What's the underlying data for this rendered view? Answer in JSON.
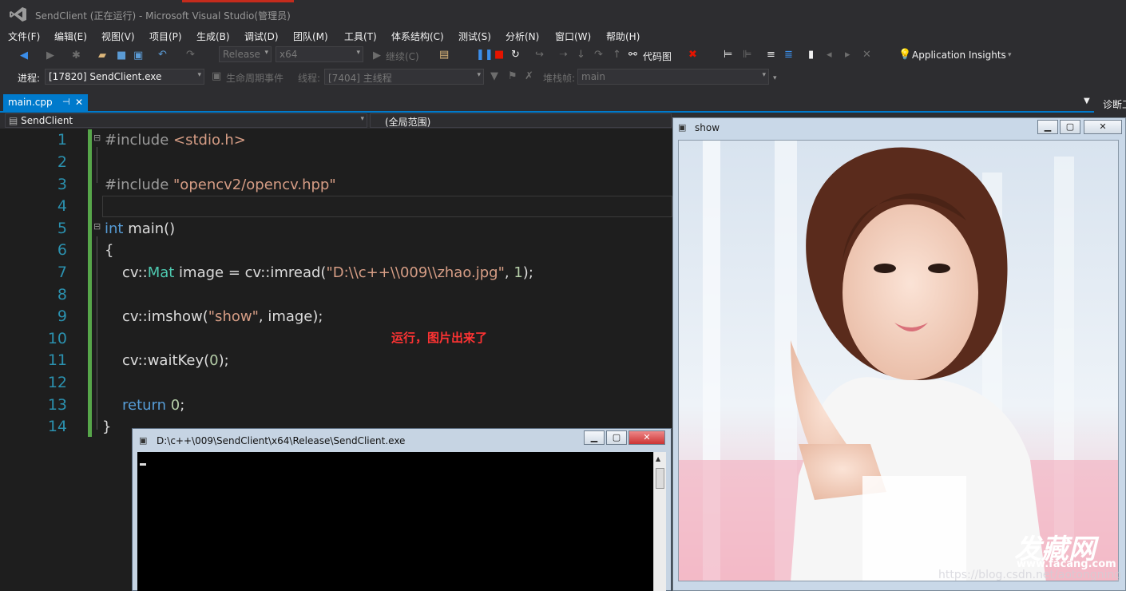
{
  "window": {
    "title": "SendClient (正在运行) - Microsoft Visual Studio(管理员)"
  },
  "menu": [
    "文件(F)",
    "编辑(E)",
    "视图(V)",
    "项目(P)",
    "生成(B)",
    "调试(D)",
    "团队(M)",
    "工具(T)",
    "体系结构(C)",
    "测试(S)",
    "分析(N)",
    "窗口(W)",
    "帮助(H)"
  ],
  "toolbar": {
    "config": "Release",
    "platform": "x64",
    "continue_label": "继续(C)",
    "codemap_label": "代码图",
    "app_insights_label": "Application Insights"
  },
  "debugbar": {
    "process_label": "进程:",
    "process_value": "[17820] SendClient.exe",
    "lifecycle_label": "生命周期事件",
    "thread_label": "线程:",
    "thread_value": "[7404] 主线程",
    "stack_label": "堆栈帧:",
    "stack_value": "main"
  },
  "tab": {
    "name": "main.cpp",
    "pin": "⊣",
    "close": "✕",
    "right_tab": "诊断工"
  },
  "nav": {
    "project": "SendClient",
    "scope": "(全局范围)"
  },
  "code_lines": [
    "1",
    "2",
    "3",
    "4",
    "5",
    "6",
    "7",
    "8",
    "9",
    "10",
    "11",
    "12",
    "13",
    "14"
  ],
  "code": {
    "l1_dir": "#include ",
    "l1_hdr": "<stdio.h>",
    "l3_dir": "#include ",
    "l3_hdr": "\"opencv2/opencv.hpp\"",
    "l5_kw": "int",
    "l5_rest": " main()",
    "l6": "{",
    "l7_a": "cv::",
    "l7_ty": "Mat",
    "l7_b": " image = cv::imread(",
    "l7_str": "\"D:\\\\c++\\\\009\\\\zhao.jpg\"",
    "l7_c": ", ",
    "l7_num": "1",
    "l7_d": ");",
    "l9_a": "cv::imshow(",
    "l9_str": "\"show\"",
    "l9_b": ", image);",
    "l11_a": "cv::waitKey(",
    "l11_num": "0",
    "l11_b": ");",
    "l13_kw": "return",
    "l13_num": "0",
    "l13_end": ";",
    "l14": "}"
  },
  "annotation": "运行，图片出来了",
  "show_window": {
    "title": "show",
    "watermark": "发藏网",
    "watermark_url": "www.facang.com",
    "csdn_url": "https://blog.csdn.net/aotongning"
  },
  "console": {
    "title": "D:\\c++\\009\\SendClient\\x64\\Release\\SendClient.exe"
  },
  "colors": {
    "accent": "#007acc",
    "bg": "#2d2d30",
    "editor": "#1e1e1e",
    "keyword": "#569cd6",
    "string": "#d69d85",
    "type": "#4ec9b0",
    "number": "#b5cea8",
    "linenum": "#2b91af",
    "annotation": "#ff3333"
  }
}
